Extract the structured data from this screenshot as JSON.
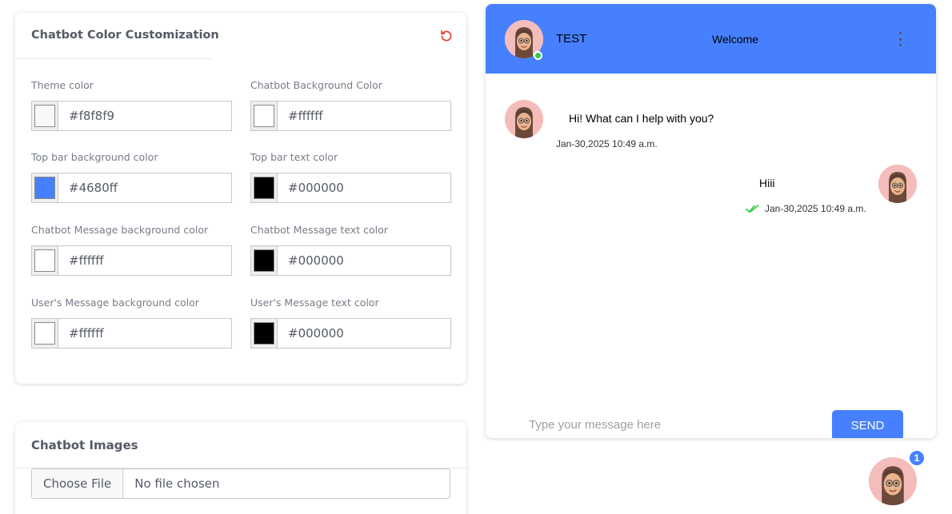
{
  "color_card": {
    "title": "Chatbot Color Customization",
    "reset_icon": "reset-icon",
    "fields": [
      {
        "label": "Theme color",
        "value": "#f8f8f9",
        "swatch": "#f8f8f9"
      },
      {
        "label": "Chatbot Background Color",
        "value": "#ffffff",
        "swatch": "#ffffff"
      },
      {
        "label": "Top bar background color",
        "value": "#4680ff",
        "swatch": "#4680ff"
      },
      {
        "label": "Top bar text color",
        "value": "#000000",
        "swatch": "#000000"
      },
      {
        "label": "Chatbot Message background color",
        "value": "#ffffff",
        "swatch": "#ffffff"
      },
      {
        "label": "Chatbot Message text color",
        "value": "#000000",
        "swatch": "#000000"
      },
      {
        "label": "User's Message background color",
        "value": "#ffffff",
        "swatch": "#ffffff"
      },
      {
        "label": "User's Message text color",
        "value": "#000000",
        "swatch": "#000000"
      }
    ]
  },
  "images_card": {
    "title": "Chatbot Images",
    "file_button": "Choose File",
    "file_status": "No file chosen"
  },
  "chat": {
    "bot_name": "TEST",
    "welcome": "Welcome",
    "menu_icon": "more-vertical-icon",
    "messages": [
      {
        "sender": "bot",
        "text": "Hi! What can I help with you?",
        "time": "Jan-30,2025 10:49 a.m."
      },
      {
        "sender": "user",
        "text": "Hiii",
        "time": "Jan-30,2025 10:49 a.m.",
        "status_icon": "double-check-icon"
      }
    ],
    "input_placeholder": "Type your message here",
    "send_label": "SEND"
  },
  "launcher": {
    "badge_count": "1"
  },
  "colors": {
    "accent": "#4680ff",
    "online": "#2ecc40",
    "reset": "#e53935"
  }
}
